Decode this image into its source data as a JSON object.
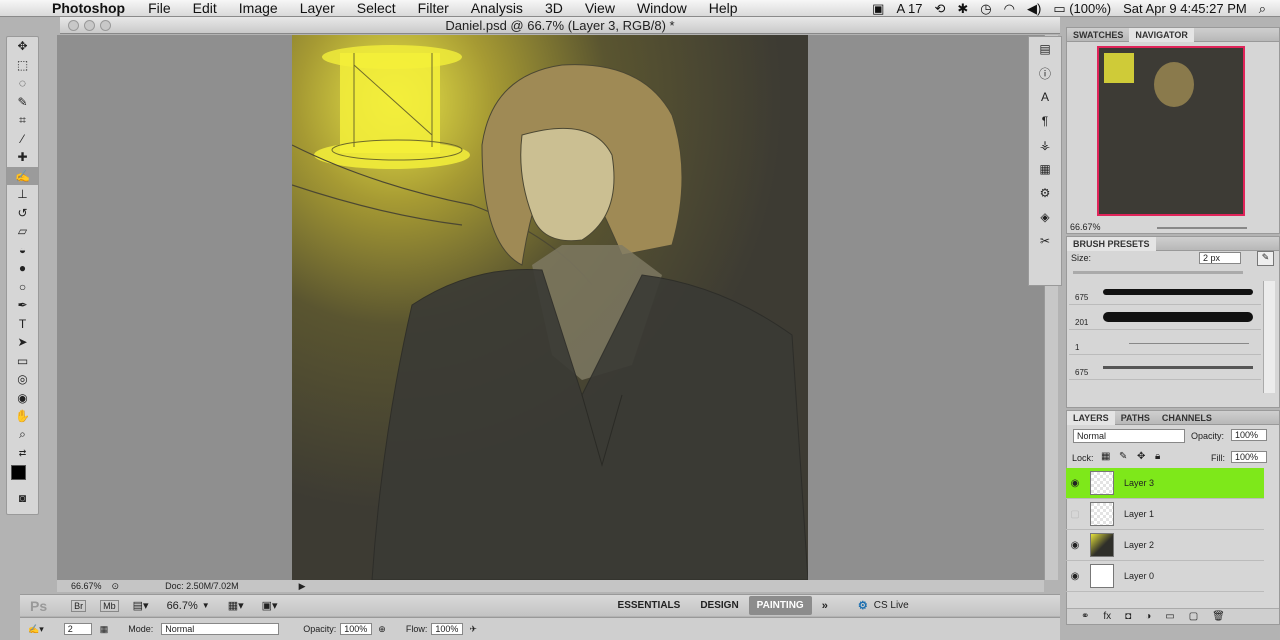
{
  "menubar": {
    "app": "Photoshop",
    "items": [
      "File",
      "Edit",
      "Image",
      "Layer",
      "Select",
      "Filter",
      "Analysis",
      "3D",
      "View",
      "Window",
      "Help"
    ],
    "right": {
      "adobe_count": "17",
      "battery": "(100%)",
      "datetime": "Sat Apr 9  4:45:27 PM"
    }
  },
  "document": {
    "title": "Daniel.psd @ 66.7% (Layer 3, RGB/8) *",
    "zoom": "66.67%",
    "doc_info": "Doc: 2.50M/7.02M"
  },
  "navigator": {
    "tabs": [
      "SWATCHES",
      "NAVIGATOR"
    ],
    "zoom": "66.67%"
  },
  "brush_presets": {
    "title": "BRUSH PRESETS",
    "size_label": "Size:",
    "size_value": "2 px",
    "presets": [
      "675",
      "201",
      "1",
      "675"
    ]
  },
  "layers": {
    "tabs": [
      "LAYERS",
      "PATHS",
      "CHANNELS"
    ],
    "blend_mode": "Normal",
    "opacity_label": "Opacity:",
    "opacity": "100%",
    "lock_label": "Lock:",
    "fill_label": "Fill:",
    "fill": "100%",
    "items": [
      {
        "name": "Layer 3",
        "visible": true,
        "selected": true
      },
      {
        "name": "Layer 1",
        "visible": false,
        "selected": false
      },
      {
        "name": "Layer 2",
        "visible": true,
        "selected": false
      },
      {
        "name": "Layer 0",
        "visible": true,
        "selected": false
      }
    ]
  },
  "appbar": {
    "zoom": "66.7%",
    "workspaces": [
      "ESSENTIALS",
      "DESIGN",
      "PAINTING"
    ],
    "active_workspace": "PAINTING",
    "cs_live": "CS Live"
  },
  "options": {
    "brush_size": "2",
    "mode_label": "Mode:",
    "mode": "Normal",
    "opacity_label": "Opacity:",
    "opacity": "100%",
    "flow_label": "Flow:",
    "flow": "100%"
  },
  "colors": {
    "selected_layer": "#7ee81a",
    "lantern": "#f4f03a",
    "navigator_frame": "#e0245a"
  }
}
